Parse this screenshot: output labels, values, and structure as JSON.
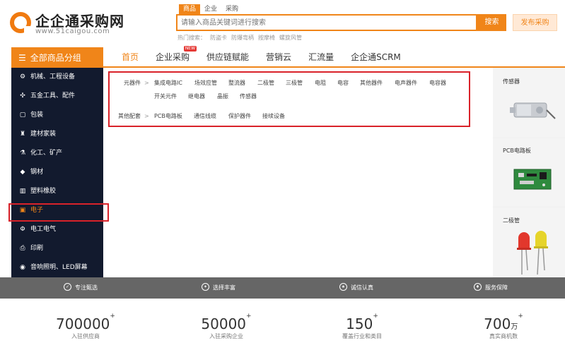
{
  "logo": {
    "title": "企企通采购网",
    "url": "www.51caigou.com"
  },
  "search": {
    "tabs": [
      "商品",
      "企业",
      "采购"
    ],
    "placeholder": "请输入商品关键词进行搜索",
    "button": "搜索",
    "publish": "发布采购",
    "hot_label": "热门搜索：",
    "hot_items": [
      "防盗卡",
      "防爆弯柄",
      "按摩椅",
      "螺旋风管"
    ]
  },
  "nav": {
    "category_label": "全部商品分组",
    "items": [
      "首页",
      "企业采购",
      "供应链赋能",
      "营销云",
      "汇流量",
      "企企通SCRM"
    ],
    "new_badge": "NEW"
  },
  "sidebar": {
    "items": [
      {
        "label": "机械、工程设备",
        "icon": "machine-icon"
      },
      {
        "label": "五金工具、配件",
        "icon": "tools-icon"
      },
      {
        "label": "包装",
        "icon": "package-icon"
      },
      {
        "label": "建材家装",
        "icon": "building-icon"
      },
      {
        "label": "化工、矿产",
        "icon": "chemical-icon"
      },
      {
        "label": "钢材",
        "icon": "steel-icon"
      },
      {
        "label": "塑料橡胶",
        "icon": "plastic-icon"
      },
      {
        "label": "电子",
        "icon": "electronics-icon"
      },
      {
        "label": "电工电气",
        "icon": "electrical-icon"
      },
      {
        "label": "印刷",
        "icon": "printing-icon"
      },
      {
        "label": "音响照明、LED屏幕",
        "icon": "lighting-icon"
      }
    ]
  },
  "panel": {
    "row1_label": "元器件",
    "row1_items": [
      "集成电路IC",
      "场效应管",
      "整流器",
      "二极管",
      "三极管",
      "电阻",
      "电容",
      "其他器件",
      "电声器件",
      "电容器"
    ],
    "row1b_items": [
      "开关元件",
      "继电器",
      "晶振",
      "传感器"
    ],
    "row2_label": "其他配套",
    "row2_items": [
      "PCB电路板",
      "通信线缆",
      "保护器件",
      "接续设备"
    ]
  },
  "right_cards": [
    "传感器",
    "PCB电路板",
    "二极管"
  ],
  "features": [
    "专注甄选",
    "选择丰富",
    "诚信认真",
    "服务保障"
  ],
  "stats": [
    {
      "value": "700000",
      "sup": "+",
      "unit": "",
      "label": "入驻供应商"
    },
    {
      "value": "50000",
      "sup": "+",
      "unit": "",
      "label": "入驻采购企业"
    },
    {
      "value": "150",
      "sup": "+",
      "unit": "",
      "label": "覆盖行业和类目"
    },
    {
      "value": "700",
      "sup": "+",
      "unit": "万",
      "label": "真实商机数"
    }
  ],
  "colors": {
    "accent": "#f08519",
    "sidebar_bg": "#121a2e",
    "highlight": "#d9222a"
  }
}
